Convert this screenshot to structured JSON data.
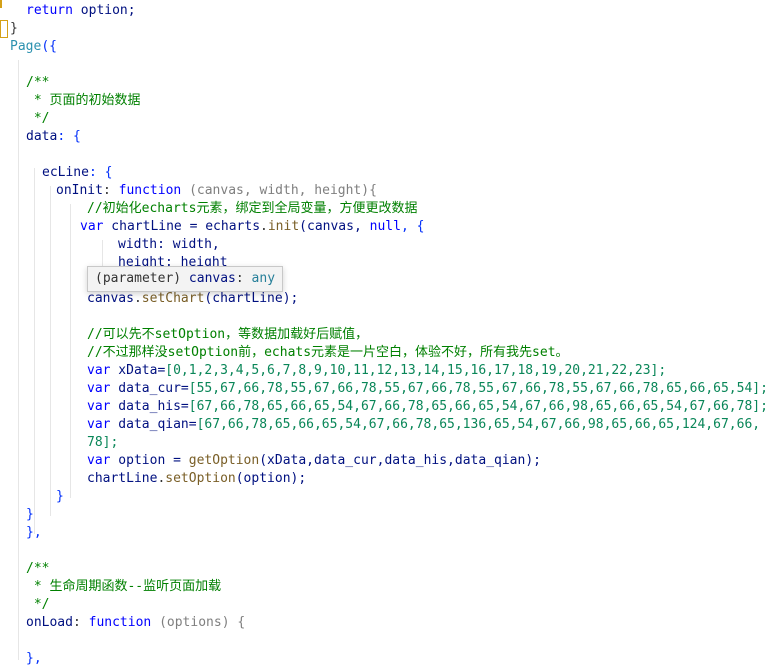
{
  "editor": {
    "language": "javascript",
    "colors": {
      "background": "#ffffff",
      "keyword": "#0000ff",
      "comment": "#008000",
      "number": "#098658",
      "function": "#795e26",
      "identifier": "#001080",
      "bracket_match": "#d4a017"
    },
    "lines": {
      "l1": {
        "kw": "return",
        "rest": " option;"
      },
      "l2": {
        "text": "}"
      },
      "l3": {
        "fn": "Page",
        "open": "({"
      },
      "l4": {
        "text": "/**"
      },
      "l5": {
        "text": " * 页面的初始数据"
      },
      "l6": {
        "text": " */"
      },
      "l7": {
        "key": "data",
        "rest": ": {"
      },
      "l8": {
        "key": "ecLine",
        "rest": ": {"
      },
      "l9": {
        "key": "onInit",
        "colon": ": ",
        "kw": "function",
        "params": " (canvas, width, height){"
      },
      "l10": {
        "text": "//初始化echarts元素，绑定到全局变量，方便更改数据"
      },
      "l11": {
        "kw": "var",
        "a": " chartLine = ",
        "b": "echarts",
        "c": ".",
        "d": "init",
        "e": "(canvas, ",
        "f": "null",
        "g": ", {"
      },
      "l12": {
        "key": "width",
        "rest": ": width,"
      },
      "l13": {
        "key": "height",
        "rest": ": height"
      },
      "l14": {
        "a": "canvas",
        "b": ".",
        "c": "setChart",
        "d": "(chartLine);"
      },
      "l15": {
        "text": "//可以先不setOption，等数据加载好后赋值，"
      },
      "l16": {
        "text": "//不过那样没setOption前，echats元素是一片空白，体验不好，所有我先set。"
      },
      "l17": {
        "kw": "var",
        "name": " xData=",
        "vals": "[0,1,2,3,4,5,6,7,8,9,10,11,12,13,14,15,16,17,18,19,20,21,22,23];"
      },
      "l18": {
        "kw": "var",
        "name": " data_cur=",
        "vals": "[55,67,66,78,55,67,66,78,55,67,66,78,55,67,66,78,55,67,66,78,65,66,65,54];"
      },
      "l19": {
        "kw": "var",
        "name": " data_his=",
        "vals": "[67,66,78,65,66,65,54,67,66,78,65,66,65,54,67,66,98,65,66,65,54,67,66,78];"
      },
      "l20": {
        "kw": "var",
        "name": " data_qian=",
        "vals": "[67,66,78,65,66,65,54,67,66,78,65,136,65,54,67,66,98,65,66,65,124,67,66,"
      },
      "l21": {
        "text": "78];"
      },
      "l22": {
        "kw": "var",
        "a": " option = ",
        "fn": "getOption",
        "b": "(xData,data_cur,data_his,data_qian);"
      },
      "l23": {
        "a": "chartLine",
        "b": ".",
        "c": "setOption",
        "d": "(option);"
      },
      "l24": {
        "text": "}"
      },
      "l25": {
        "text": "}"
      },
      "l26": {
        "text": "},"
      },
      "l27": {
        "text": "/**"
      },
      "l28": {
        "text": " * 生命周期函数--监听页面加载"
      },
      "l29": {
        "text": " */"
      },
      "l30": {
        "key": "onLoad",
        "colon": ": ",
        "kw": "function",
        "params": " (options) {"
      },
      "l31": {
        "text": "},"
      }
    }
  },
  "tooltip": {
    "prefix": "(parameter) ",
    "param": "canvas",
    "sep": ": ",
    "type": "any"
  }
}
